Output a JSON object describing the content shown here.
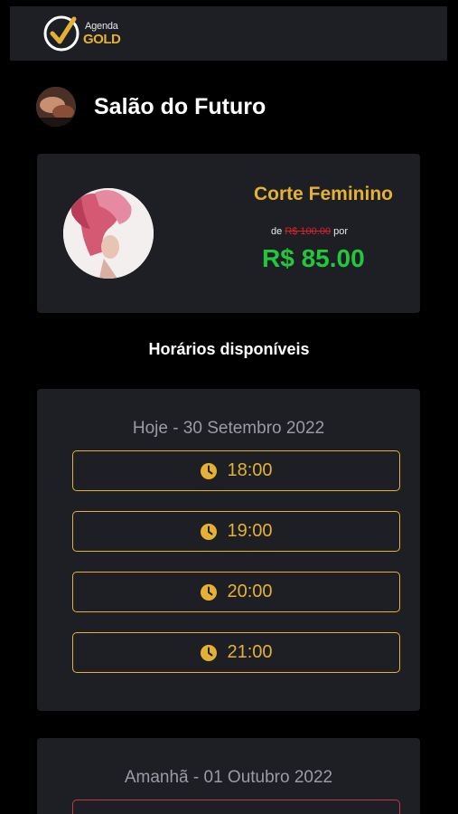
{
  "header": {
    "logo_top": "Agenda",
    "logo_bottom": "GOLD"
  },
  "salon": {
    "name": "Salão do Futuro"
  },
  "service": {
    "title": "Corte Feminino",
    "price_prefix": "de",
    "old_price": "R$ 100.00",
    "price_suffix": "por",
    "new_price": "R$ 85.00"
  },
  "schedule": {
    "title": "Horários disponíveis",
    "days": [
      {
        "title": "Hoje - 30 Setembro 2022",
        "slots": [
          "18:00",
          "19:00",
          "20:00",
          "21:00"
        ]
      },
      {
        "title": "Amanhã - 01 Outubro 2022",
        "slots": []
      }
    ]
  },
  "colors": {
    "accent_gold": "#e5b132",
    "price_green": "#23c73b",
    "old_price_red": "#d8232a",
    "card_bg": "#1d1f25",
    "page_bg": "#000000"
  }
}
